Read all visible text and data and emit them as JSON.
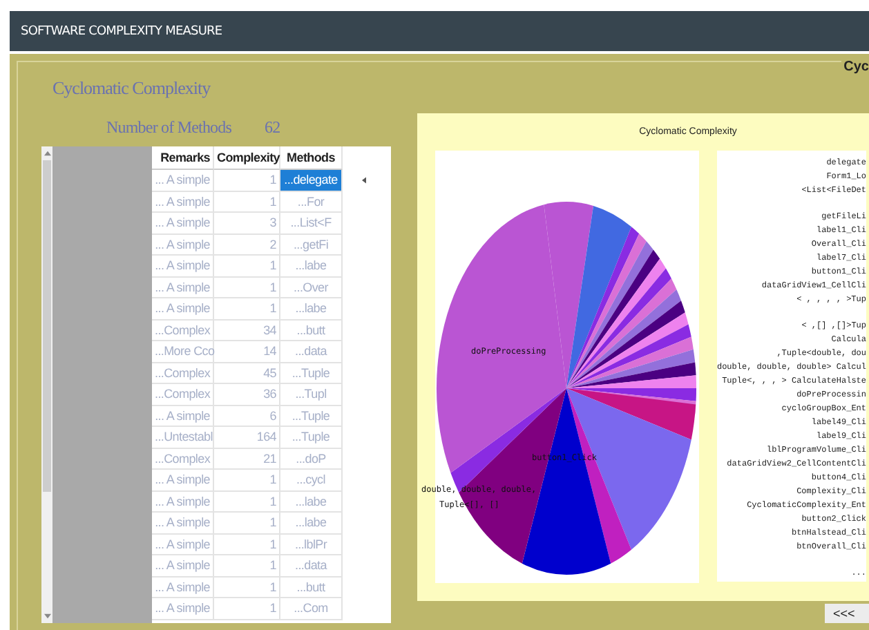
{
  "window": {
    "title": "SOFTWARE COMPLEXITY MEASURE"
  },
  "group": {
    "title": "Cyc"
  },
  "heading": "Cyclomatic Complexity",
  "method_count": {
    "label": "Number of Methods",
    "value": "62"
  },
  "table": {
    "columns": [
      "Remarks",
      "Complexity",
      "Methods"
    ],
    "rows": [
      {
        "remarks": "... A simple",
        "complexity": "1",
        "method": "...delegate",
        "selected": true
      },
      {
        "remarks": "... A simple",
        "complexity": "1",
        "method": "...For",
        "selected": false
      },
      {
        "remarks": "... A simple",
        "complexity": "3",
        "method": "...List<F",
        "selected": false
      },
      {
        "remarks": "... A simple",
        "complexity": "2",
        "method": "...getFi",
        "selected": false
      },
      {
        "remarks": "... A simple",
        "complexity": "1",
        "method": "...labe",
        "selected": false
      },
      {
        "remarks": "... A simple",
        "complexity": "1",
        "method": "...Over",
        "selected": false
      },
      {
        "remarks": "... A simple",
        "complexity": "1",
        "method": "...labe",
        "selected": false
      },
      {
        "remarks": "...Complex",
        "complexity": "34",
        "method": "...butt",
        "selected": false
      },
      {
        "remarks": "...More Cco",
        "complexity": "14",
        "method": "...data",
        "selected": false
      },
      {
        "remarks": "...Complex",
        "complexity": "45",
        "method": "...Tuple",
        "selected": false
      },
      {
        "remarks": "...Complex",
        "complexity": "36",
        "method": "...Tupl",
        "selected": false
      },
      {
        "remarks": "... A simple",
        "complexity": "6",
        "method": "...Tuple",
        "selected": false
      },
      {
        "remarks": "...Untestabl",
        "complexity": "164",
        "method": "...Tuple",
        "selected": false
      },
      {
        "remarks": "...Complex",
        "complexity": "21",
        "method": "...doP",
        "selected": false
      },
      {
        "remarks": "... A simple",
        "complexity": "1",
        "method": "...cycl",
        "selected": false
      },
      {
        "remarks": "... A simple",
        "complexity": "1",
        "method": "...labe",
        "selected": false
      },
      {
        "remarks": "... A simple",
        "complexity": "1",
        "method": "...labe",
        "selected": false
      },
      {
        "remarks": "... A simple",
        "complexity": "1",
        "method": "...lblPr",
        "selected": false
      },
      {
        "remarks": "... A simple",
        "complexity": "1",
        "method": "...data",
        "selected": false
      },
      {
        "remarks": "... A simple",
        "complexity": "1",
        "method": "...butt",
        "selected": false
      },
      {
        "remarks": "... A simple",
        "complexity": "1",
        "method": "...Com",
        "selected": false
      }
    ]
  },
  "chart": {
    "title": "Cyclomatic Complexity",
    "slice_labels": [
      {
        "text": "doPreProcessing",
        "kind": "upper"
      },
      {
        "text": "button1_Click",
        "kind": "center"
      },
      {
        "text": "double, double, double,",
        "kind": "left"
      },
      {
        "text": "Tuple<[], []",
        "kind": "left"
      }
    ],
    "legend_groups": [
      {
        "entries": [
          "delegate",
          "Form1_Lo",
          "<List<FileDet"
        ]
      },
      {
        "entries": [
          "getFileLi",
          "label1_Cli",
          "Overall_Cli",
          "label7_Cli",
          "button1_Cli",
          "dataGridView1_CellCli",
          "< , , , , >Tup"
        ]
      },
      {
        "entries": [
          "< ,[] ,[]>Tup",
          "Calcula",
          ",Tuple<double, dou",
          "double, double, double> Calcul",
          "Tuple<, , , > CalculateHalste",
          "doPreProcessin",
          "cycloGroupBox_Ent",
          "label49_Cli",
          "label9_Cli",
          "lblProgramVolume_Cli",
          "dataGridView2_CellContentCli",
          "button4_Cli",
          "Complexity_Cli",
          "CyclomaticComplexity_Ent",
          "button2_Click",
          "btnHalstead_Cli",
          "btnOverall_Cli"
        ]
      },
      {
        "entries": [
          "..."
        ]
      }
    ]
  },
  "back_button": "<<<"
}
